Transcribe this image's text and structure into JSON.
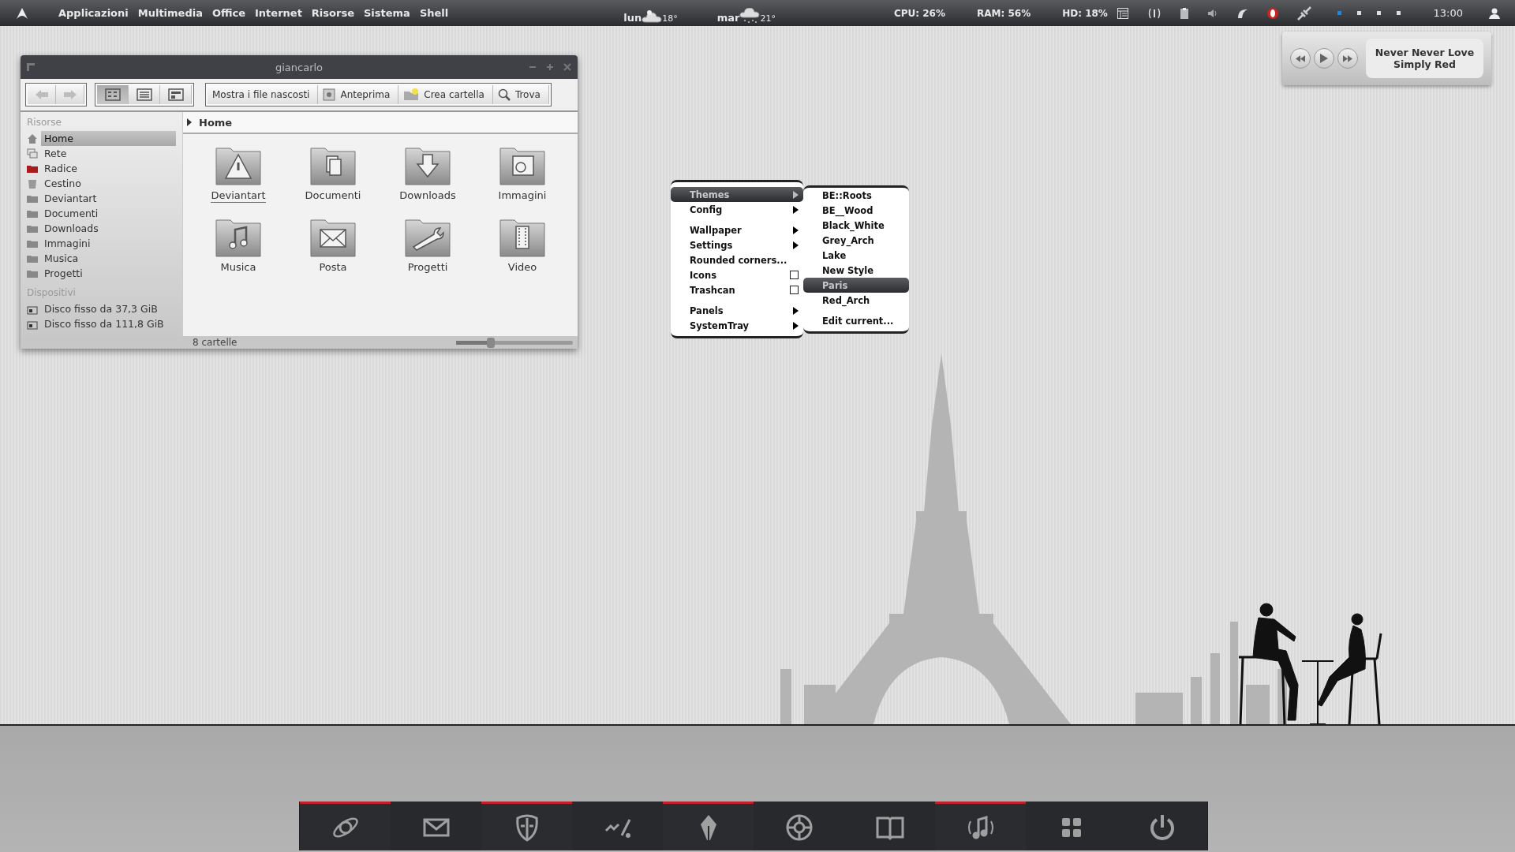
{
  "top_panel": {
    "menu": [
      "Applicazioni",
      "Multimedia",
      "Office",
      "Internet",
      "Risorse",
      "Sistema",
      "Shell"
    ],
    "weather": [
      {
        "day": "lun",
        "temp": "18°",
        "kind": "cloudy"
      },
      {
        "day": "mar",
        "temp": "21°",
        "kind": "snow"
      }
    ],
    "stats": [
      "CPU: 26%",
      "RAM: 56%",
      "HD: 18%"
    ],
    "workspaces": [
      {
        "selected": true
      },
      {
        "selected": false
      },
      {
        "selected": false
      },
      {
        "selected": false
      }
    ],
    "clock": "13:00"
  },
  "file_manager": {
    "title": "giancarlo",
    "nav_buttons": [
      {
        "disabled": true
      },
      {
        "disabled": true
      }
    ],
    "view_buttons": [
      {
        "selected": true
      },
      {
        "selected": false
      },
      {
        "selected": false
      }
    ],
    "actions": [
      {
        "label": "Mostra i file nascosti",
        "kind": "plain"
      },
      {
        "label": "Anteprima",
        "kind": "preview"
      },
      {
        "label": "Crea cartella",
        "kind": "newfolder"
      },
      {
        "label": "Trova",
        "kind": "search"
      }
    ],
    "sidebar": [
      {
        "title": "Risorse",
        "items": [
          {
            "label": "Home",
            "kind": "home",
            "selected": true
          },
          {
            "label": "Rete",
            "kind": "network",
            "selected": false
          },
          {
            "label": "Radice",
            "kind": "root",
            "selected": false
          },
          {
            "label": "Cestino",
            "kind": "trash",
            "selected": false
          },
          {
            "label": "Deviantart",
            "kind": "folder",
            "selected": false
          },
          {
            "label": "Documenti",
            "kind": "folder",
            "selected": false
          },
          {
            "label": "Downloads",
            "kind": "folder",
            "selected": false
          },
          {
            "label": "Immagini",
            "kind": "folder",
            "selected": false
          },
          {
            "label": "Musica",
            "kind": "folder",
            "selected": false
          },
          {
            "label": "Progetti",
            "kind": "folder",
            "selected": false
          }
        ]
      },
      {
        "title": "Dispositivi",
        "items": [
          {
            "label": "Disco fisso da 37,3 GiB",
            "kind": "drive",
            "selected": false
          },
          {
            "label": "Disco fisso da 111,8 GiB",
            "kind": "drive",
            "selected": false
          }
        ]
      }
    ],
    "path": "Home",
    "folders": [
      {
        "label": "Deviantart",
        "focused": true
      },
      {
        "label": "Documenti",
        "focused": false
      },
      {
        "label": "Downloads",
        "focused": false
      },
      {
        "label": "Immagini",
        "focused": false
      },
      {
        "label": "Musica",
        "focused": false
      },
      {
        "label": "Posta",
        "focused": false
      },
      {
        "label": "Progetti",
        "focused": false
      },
      {
        "label": "Video",
        "focused": false
      }
    ],
    "status": "8 cartelle",
    "zoom": {
      "level": 0.3
    }
  },
  "theme_menu": {
    "groups": [
      [
        {
          "label": "Themes",
          "kind": "submenu",
          "selected": true
        },
        {
          "label": "Config",
          "kind": "submenu",
          "selected": false
        }
      ],
      [
        {
          "label": "Wallpaper",
          "kind": "submenu",
          "selected": false
        },
        {
          "label": "Settings",
          "kind": "submenu",
          "selected": false
        },
        {
          "label": "Rounded corners...",
          "kind": "action",
          "selected": false
        },
        {
          "label": "Icons",
          "kind": "checkbox",
          "checked": false,
          "selected": false
        },
        {
          "label": "Trashcan",
          "kind": "checkbox",
          "checked": false,
          "selected": false
        }
      ],
      [
        {
          "label": "Panels",
          "kind": "submenu",
          "selected": false
        },
        {
          "label": "SystemTray",
          "kind": "submenu",
          "selected": false
        }
      ]
    ],
    "submenu": [
      [
        {
          "label": "BE::Roots",
          "selected": false
        },
        {
          "label": "BE__Wood",
          "selected": false
        },
        {
          "label": "Black_White",
          "selected": false
        },
        {
          "label": "Grey_Arch",
          "selected": false
        },
        {
          "label": "Lake",
          "selected": false
        },
        {
          "label": "New Style",
          "selected": false
        },
        {
          "label": "Paris",
          "selected": true
        },
        {
          "label": "Red_Arch",
          "selected": false
        }
      ],
      [
        {
          "label": "Edit current...",
          "selected": false
        }
      ]
    ]
  },
  "music_player": {
    "title": "Never Never Love",
    "artist": "Simply Red"
  },
  "dock": [
    {
      "running": true
    },
    {
      "running": false
    },
    {
      "running": true
    },
    {
      "running": false
    },
    {
      "running": true
    },
    {
      "running": false
    },
    {
      "running": false
    },
    {
      "running": true
    },
    {
      "running": false
    },
    {
      "running": false
    }
  ]
}
